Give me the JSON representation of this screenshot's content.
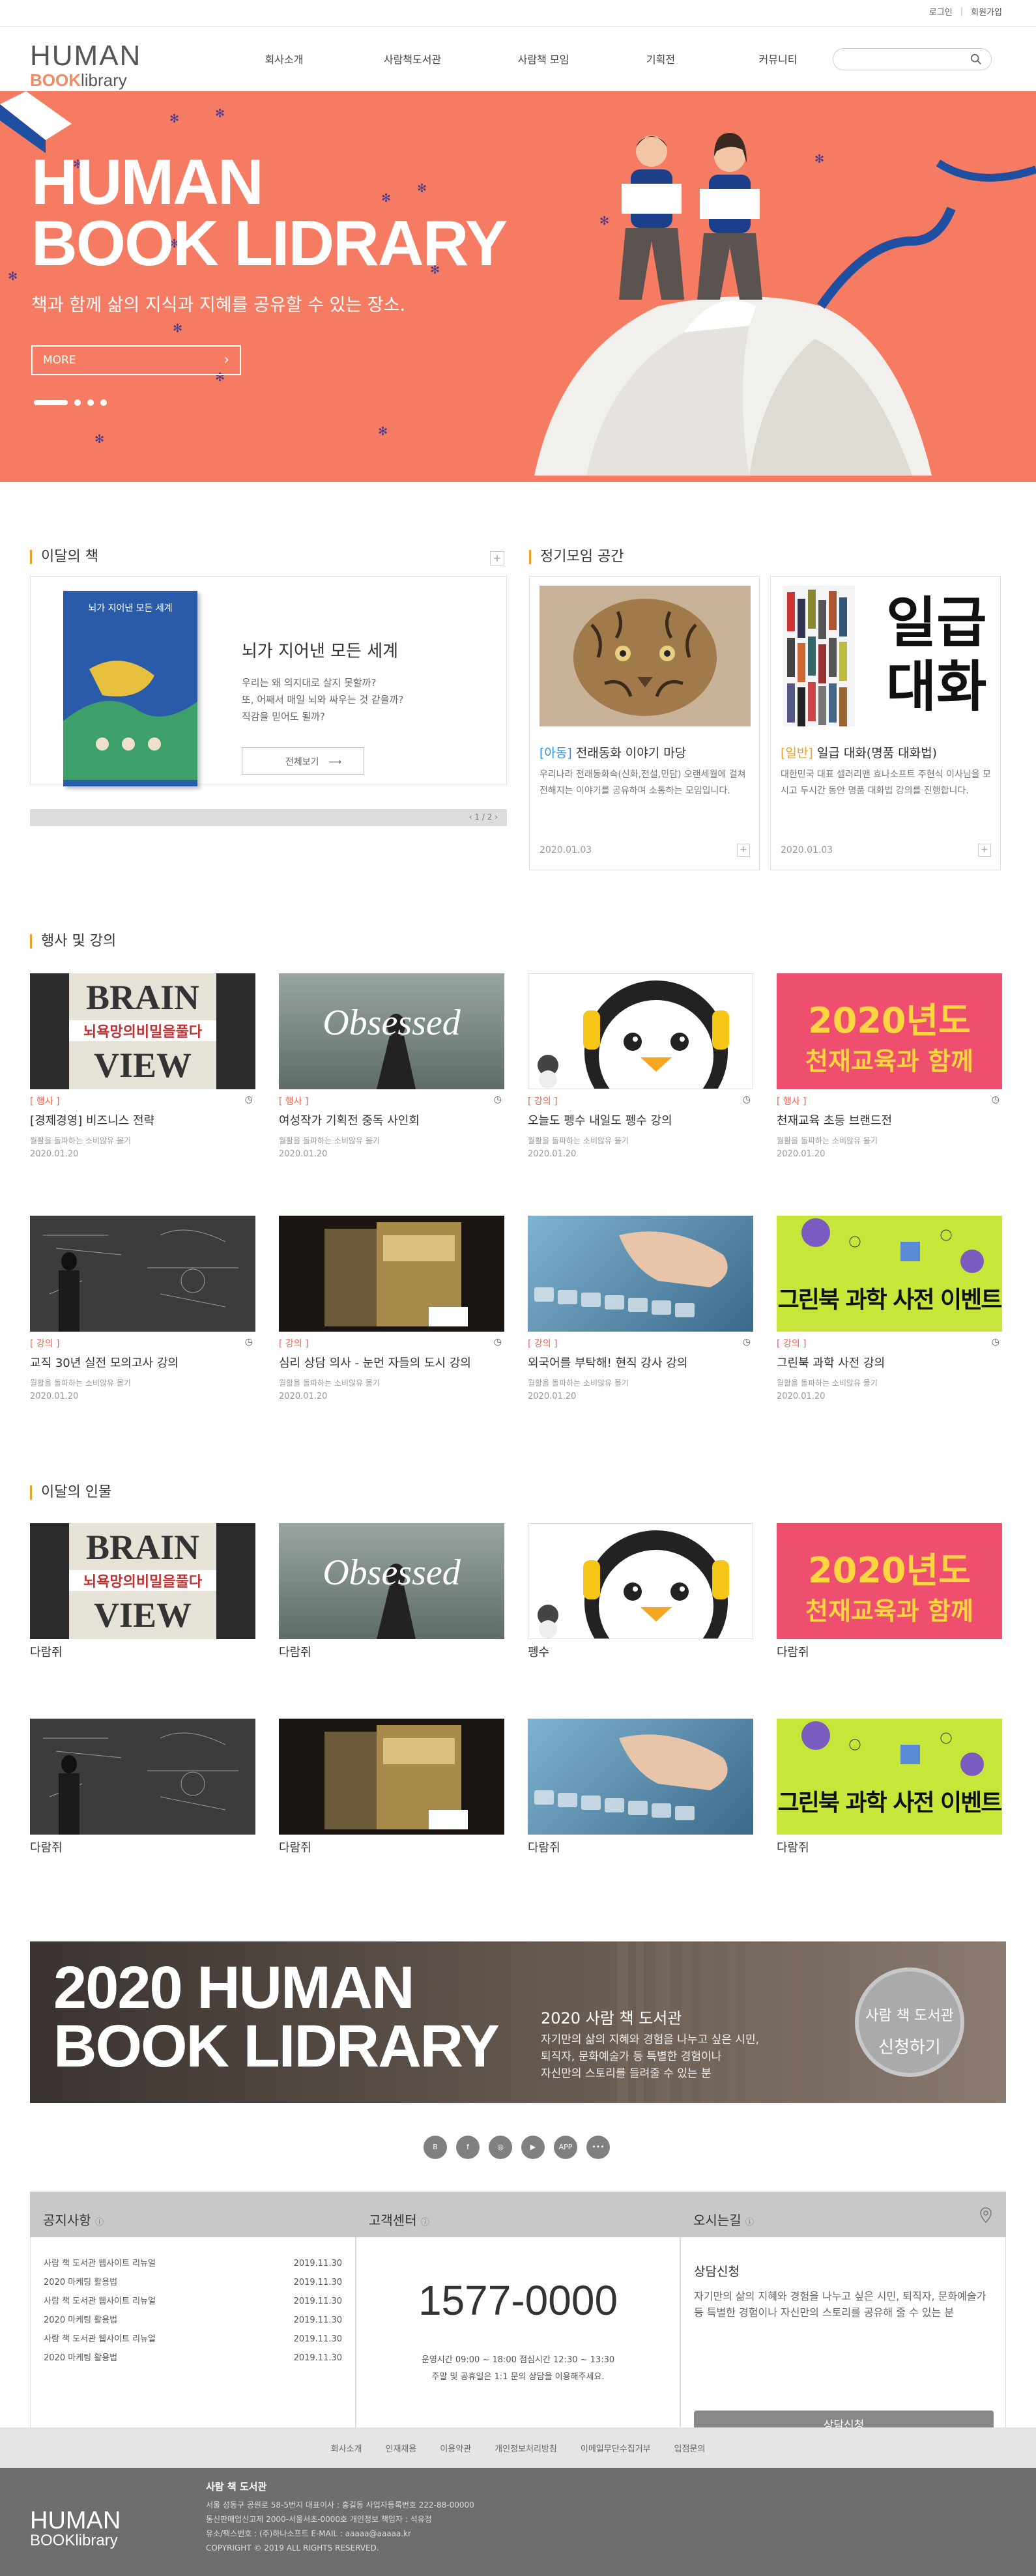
{
  "util": {
    "login": "로그인",
    "signup": "회원가입"
  },
  "logo": {
    "line1": "HUMAN",
    "line2a": "BOOK",
    "line2b": "library"
  },
  "gnb": [
    "회사소개",
    "사람책도서관",
    "사람책 모임",
    "기획전",
    "커뮤니티"
  ],
  "search": {
    "placeholder": ""
  },
  "hero": {
    "title1": "HUMAN",
    "title2": "BOOK LIDRARY",
    "subtitle": "책과 함께 삶의 지식과 지혜를 공유할 수 있는 장소.",
    "more": "MORE"
  },
  "sections": {
    "book": "이달의 책",
    "meeting": "정기모임 공간",
    "events": "행사 및 강의",
    "people": "이달의 인물"
  },
  "book": {
    "cover_title": "뇌가 지어낸 모든 세계",
    "title": "뇌가 지어낸 모든 세계",
    "desc1": "우리는 왜 의지대로 살지 못할까?",
    "desc2": "또, 어째서 매일 뇌와 싸우는 것 같을까?",
    "desc3": "직감을 믿어도 될까?",
    "button": "전체보기",
    "pager": "1 / 2"
  },
  "meetings": [
    {
      "tag": "[아동]",
      "title": "전래동화 이야기 마당",
      "desc": "우리나라 전래동화속(신화,전설,민담) 오랜세월에 걸쳐 전해지는 이야기를 공유하며 소통하는 모임입니다.",
      "date": "2020.01.03",
      "img_text": ""
    },
    {
      "tag": "[일반]",
      "title": "일급 대화(명품 대화법)",
      "desc": "대한민국 대표 셀러리맨 효나소프트 주현식 이사님을 모시고 두시간 동안 명품 대화법 강의를 진행합니다.",
      "date": "2020.01.03",
      "img_text1": "일급",
      "img_text2": "대화"
    }
  ],
  "events": [
    {
      "tag": "[ 행사 ]",
      "title": "[경제경영] 비즈니스 전략",
      "desc": "월활을 돌파하는 소비않유 몰기",
      "date": "2020.01.20",
      "img": "brain"
    },
    {
      "tag": "[ 행사 ]",
      "title": "여성작가 기획전 중독 사인회",
      "desc": "월활을 돌파하는 소비않유 몰기",
      "date": "2020.01.20",
      "img": "obsessed"
    },
    {
      "tag": "[ 강의 ]",
      "title": "오늘도 펭수 내일도 펭수 강의",
      "desc": "월활을 돌파하는 소비않유 몰기",
      "date": "2020.01.20",
      "img": "peng"
    },
    {
      "tag": "[ 행사 ]",
      "title": "천재교육 초등 브랜드전",
      "desc": "월활을 돌파하는 소비않유 몰기",
      "date": "2020.01.20",
      "img": "genius"
    },
    {
      "tag": "[ 강의 ]",
      "title": "교직 30년 실전 모의고사 강의",
      "desc": "월활을 돌파하는 소비않유 몰기",
      "date": "2020.01.20",
      "img": "board"
    },
    {
      "tag": "[ 강의 ]",
      "title": "심리 상담 의사 - 눈먼 자들의 도시 강의",
      "desc": "월활을 돌파하는 소비않유 몰기",
      "date": "2020.01.20",
      "img": "books"
    },
    {
      "tag": "[ 강의 ]",
      "title": "외국어를 부탁해! 현직 강사 강의",
      "desc": "월활을 돌파하는 소비않유 몰기",
      "date": "2020.01.20",
      "img": "keyboard"
    },
    {
      "tag": "[ 강의 ]",
      "title": "그린북 과학 사전 강의",
      "desc": "월활을 돌파하는 소비않유 몰기",
      "date": "2020.01.20",
      "img": "green"
    }
  ],
  "event_img_text": {
    "brain1": "BRAIN",
    "brain2": "뇌욕망의비밀을풀다",
    "brain3": "VIEW",
    "obsessed": "Obsessed",
    "genius1": "2020년도",
    "genius2": "천재교육과 함께",
    "green": "그린북 과학 사전 이벤트"
  },
  "people": [
    {
      "name": "다람쥐",
      "img": "brain"
    },
    {
      "name": "다람쥐",
      "img": "obsessed"
    },
    {
      "name": "펭수",
      "img": "peng"
    },
    {
      "name": "다람쥐",
      "img": "genius"
    },
    {
      "name": "다람쥐",
      "img": "board"
    },
    {
      "name": "다람쥐",
      "img": "books"
    },
    {
      "name": "다람쥐",
      "img": "keyboard"
    },
    {
      "name": "다람쥐",
      "img": "green"
    }
  ],
  "banner": {
    "big1": "2020 HUMAN",
    "big2": "BOOK LIDRARY",
    "t1": "2020 사람 책 도서관",
    "t2a": "자기만의 삶의 지혜와 경험을 나누고 싶은 시민,",
    "t2b": "퇴직자, 문화예술가 등 특별한 경험이나",
    "t2c": "자신만의 스토리를 들려줄 수 있는 분",
    "circle1": "사람 책 도서관",
    "circle2": "신청하기"
  },
  "social": [
    "B",
    "f",
    "◎",
    "▶",
    "APP",
    "•••"
  ],
  "notice": {
    "title": "공지사항",
    "items": [
      {
        "t": "사람 책 도서관 웹사이트 리뉴얼",
        "d": "2019.11.30"
      },
      {
        "t": "2020 마케팅 활용법",
        "d": "2019.11.30"
      },
      {
        "t": "사람 책 도서관 웹사이트 리뉴얼",
        "d": "2019.11.30"
      },
      {
        "t": "2020 마케팅 활용법",
        "d": "2019.11.30"
      },
      {
        "t": "사람 책 도서관 웹사이트 리뉴얼",
        "d": "2019.11.30"
      },
      {
        "t": "2020 마케팅 활용법",
        "d": "2019.11.30"
      }
    ]
  },
  "cs": {
    "title": "고객센터",
    "phone": "1577-0000",
    "hours1": "운영시간 09:00 ~ 18:00  점심시간 12:30 ~ 13:30",
    "hours2": "주말 및 공휴일은 1:1 문의 상담을 이용해주세요."
  },
  "way": {
    "title": "오시는길",
    "sub": "상담신청",
    "desc": "자기만의 삶의 지혜와 경험을 나누고 싶은 시민, 퇴직자, 문화예술가 등 특별한 경험이나 자신만의 스토리를 공유해 줄 수 있는 분",
    "button": "상담신청"
  },
  "fnav": [
    "회사소개",
    "인재채용",
    "이용약관",
    "개인정보처리방침",
    "이메일무단수집거부",
    "입점문의"
  ],
  "footer": {
    "logo1": "HUMAN",
    "logo2": "BOOKlibrary",
    "name": "사람 책 도서관",
    "l1": "서울 성동구 공원로 58-5번지  대표이사 : 홍길동  사업자등록번호 222-88-00000",
    "l2": "통신판매업신고제 2000-서울서초-0000호  개인정보 책임자 : 석유정",
    "l3": "유소/팩스번호 : (주)하나소프트  E-MAIL : aaaaa@aaaaa.kr",
    "copy": "COPYRIGHT © 2019 ALL RIGHTS RESERVED."
  }
}
